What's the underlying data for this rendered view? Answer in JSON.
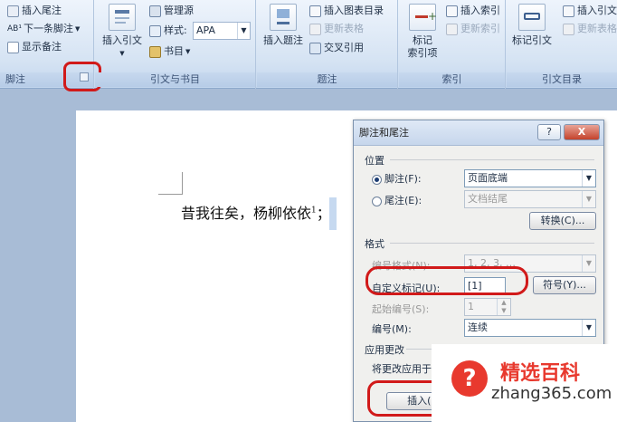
{
  "ribbon": {
    "footnotes": {
      "label": "脚注",
      "insert_endnote": "插入尾注",
      "next_footnote": "下一条脚注",
      "show_notes": "显示备注",
      "next_prefix": "AB¹"
    },
    "citations": {
      "label": "引文与书目",
      "insert_citation": "插入引文",
      "manage_sources": "管理源",
      "style_label": "样式:",
      "style_value": "APA",
      "bibliography": "书目"
    },
    "captions": {
      "label": "题注",
      "insert_caption": "插入题注",
      "insert_table_of_figures": "插入图表目录",
      "update_table": "更新表格",
      "cross_reference": "交叉引用"
    },
    "index": {
      "label": "索引",
      "mark_entry": "标记\n索引项",
      "insert_index": "插入索引",
      "update_index": "更新索引"
    },
    "table_of_authorities": {
      "label": "引文目录",
      "mark_citation": "标记引文",
      "insert_toa": "插入引文",
      "update_table": "更新表格"
    }
  },
  "document": {
    "line": "昔我往矣，杨柳依依",
    "footnote_ref": "1",
    "punct": "；"
  },
  "dialog": {
    "title": "脚注和尾注",
    "help": "?",
    "close": "X",
    "location": {
      "heading": "位置",
      "footnotes_label": "脚注(F):",
      "footnotes_value": "页面底端",
      "endnotes_label": "尾注(E):",
      "endnotes_value": "文档结尾",
      "convert": "转换(C)..."
    },
    "format": {
      "heading": "格式",
      "number_format_label": "编号格式(N):",
      "number_format_value": "1, 2, 3, …",
      "custom_mark_label": "自定义标记(U):",
      "custom_mark_value": "[1]",
      "symbol": "符号(Y)...",
      "start_at_label": "起始编号(S):",
      "start_at_value": "1",
      "numbering_label": "编号(M):",
      "numbering_value": "连续"
    },
    "apply": {
      "heading": "应用更改",
      "apply_to_label": "将更改应用于",
      "insert": "插入(I)"
    }
  },
  "watermark": {
    "brand": "精选百科",
    "url": "zhang365.com",
    "icon": "?"
  },
  "colors": {
    "highlight": "#d11a1a",
    "brand": "#e8392e"
  }
}
